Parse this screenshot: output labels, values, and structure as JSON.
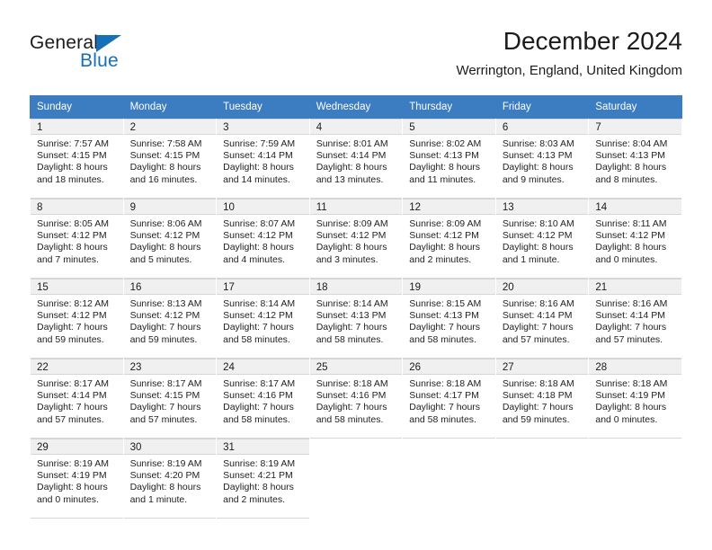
{
  "logo": {
    "word_dark": "General",
    "word_blue": "Blue",
    "triangle_color": "#1570b8"
  },
  "header": {
    "title": "December 2024",
    "subtitle": "Werrington, England, United Kingdom",
    "header_bg": "#3c7cc0",
    "daynum_bg": "#f0f0f0"
  },
  "weekdays": [
    "Sunday",
    "Monday",
    "Tuesday",
    "Wednesday",
    "Thursday",
    "Friday",
    "Saturday"
  ],
  "weeks": [
    [
      {
        "day": "1",
        "sunrise": "Sunrise: 7:57 AM",
        "sunset": "Sunset: 4:15 PM",
        "daylight1": "Daylight: 8 hours",
        "daylight2": "and 18 minutes."
      },
      {
        "day": "2",
        "sunrise": "Sunrise: 7:58 AM",
        "sunset": "Sunset: 4:15 PM",
        "daylight1": "Daylight: 8 hours",
        "daylight2": "and 16 minutes."
      },
      {
        "day": "3",
        "sunrise": "Sunrise: 7:59 AM",
        "sunset": "Sunset: 4:14 PM",
        "daylight1": "Daylight: 8 hours",
        "daylight2": "and 14 minutes."
      },
      {
        "day": "4",
        "sunrise": "Sunrise: 8:01 AM",
        "sunset": "Sunset: 4:14 PM",
        "daylight1": "Daylight: 8 hours",
        "daylight2": "and 13 minutes."
      },
      {
        "day": "5",
        "sunrise": "Sunrise: 8:02 AM",
        "sunset": "Sunset: 4:13 PM",
        "daylight1": "Daylight: 8 hours",
        "daylight2": "and 11 minutes."
      },
      {
        "day": "6",
        "sunrise": "Sunrise: 8:03 AM",
        "sunset": "Sunset: 4:13 PM",
        "daylight1": "Daylight: 8 hours",
        "daylight2": "and 9 minutes."
      },
      {
        "day": "7",
        "sunrise": "Sunrise: 8:04 AM",
        "sunset": "Sunset: 4:13 PM",
        "daylight1": "Daylight: 8 hours",
        "daylight2": "and 8 minutes."
      }
    ],
    [
      {
        "day": "8",
        "sunrise": "Sunrise: 8:05 AM",
        "sunset": "Sunset: 4:12 PM",
        "daylight1": "Daylight: 8 hours",
        "daylight2": "and 7 minutes."
      },
      {
        "day": "9",
        "sunrise": "Sunrise: 8:06 AM",
        "sunset": "Sunset: 4:12 PM",
        "daylight1": "Daylight: 8 hours",
        "daylight2": "and 5 minutes."
      },
      {
        "day": "10",
        "sunrise": "Sunrise: 8:07 AM",
        "sunset": "Sunset: 4:12 PM",
        "daylight1": "Daylight: 8 hours",
        "daylight2": "and 4 minutes."
      },
      {
        "day": "11",
        "sunrise": "Sunrise: 8:09 AM",
        "sunset": "Sunset: 4:12 PM",
        "daylight1": "Daylight: 8 hours",
        "daylight2": "and 3 minutes."
      },
      {
        "day": "12",
        "sunrise": "Sunrise: 8:09 AM",
        "sunset": "Sunset: 4:12 PM",
        "daylight1": "Daylight: 8 hours",
        "daylight2": "and 2 minutes."
      },
      {
        "day": "13",
        "sunrise": "Sunrise: 8:10 AM",
        "sunset": "Sunset: 4:12 PM",
        "daylight1": "Daylight: 8 hours",
        "daylight2": "and 1 minute."
      },
      {
        "day": "14",
        "sunrise": "Sunrise: 8:11 AM",
        "sunset": "Sunset: 4:12 PM",
        "daylight1": "Daylight: 8 hours",
        "daylight2": "and 0 minutes."
      }
    ],
    [
      {
        "day": "15",
        "sunrise": "Sunrise: 8:12 AM",
        "sunset": "Sunset: 4:12 PM",
        "daylight1": "Daylight: 7 hours",
        "daylight2": "and 59 minutes."
      },
      {
        "day": "16",
        "sunrise": "Sunrise: 8:13 AM",
        "sunset": "Sunset: 4:12 PM",
        "daylight1": "Daylight: 7 hours",
        "daylight2": "and 59 minutes."
      },
      {
        "day": "17",
        "sunrise": "Sunrise: 8:14 AM",
        "sunset": "Sunset: 4:12 PM",
        "daylight1": "Daylight: 7 hours",
        "daylight2": "and 58 minutes."
      },
      {
        "day": "18",
        "sunrise": "Sunrise: 8:14 AM",
        "sunset": "Sunset: 4:13 PM",
        "daylight1": "Daylight: 7 hours",
        "daylight2": "and 58 minutes."
      },
      {
        "day": "19",
        "sunrise": "Sunrise: 8:15 AM",
        "sunset": "Sunset: 4:13 PM",
        "daylight1": "Daylight: 7 hours",
        "daylight2": "and 58 minutes."
      },
      {
        "day": "20",
        "sunrise": "Sunrise: 8:16 AM",
        "sunset": "Sunset: 4:14 PM",
        "daylight1": "Daylight: 7 hours",
        "daylight2": "and 57 minutes."
      },
      {
        "day": "21",
        "sunrise": "Sunrise: 8:16 AM",
        "sunset": "Sunset: 4:14 PM",
        "daylight1": "Daylight: 7 hours",
        "daylight2": "and 57 minutes."
      }
    ],
    [
      {
        "day": "22",
        "sunrise": "Sunrise: 8:17 AM",
        "sunset": "Sunset: 4:14 PM",
        "daylight1": "Daylight: 7 hours",
        "daylight2": "and 57 minutes."
      },
      {
        "day": "23",
        "sunrise": "Sunrise: 8:17 AM",
        "sunset": "Sunset: 4:15 PM",
        "daylight1": "Daylight: 7 hours",
        "daylight2": "and 57 minutes."
      },
      {
        "day": "24",
        "sunrise": "Sunrise: 8:17 AM",
        "sunset": "Sunset: 4:16 PM",
        "daylight1": "Daylight: 7 hours",
        "daylight2": "and 58 minutes."
      },
      {
        "day": "25",
        "sunrise": "Sunrise: 8:18 AM",
        "sunset": "Sunset: 4:16 PM",
        "daylight1": "Daylight: 7 hours",
        "daylight2": "and 58 minutes."
      },
      {
        "day": "26",
        "sunrise": "Sunrise: 8:18 AM",
        "sunset": "Sunset: 4:17 PM",
        "daylight1": "Daylight: 7 hours",
        "daylight2": "and 58 minutes."
      },
      {
        "day": "27",
        "sunrise": "Sunrise: 8:18 AM",
        "sunset": "Sunset: 4:18 PM",
        "daylight1": "Daylight: 7 hours",
        "daylight2": "and 59 minutes."
      },
      {
        "day": "28",
        "sunrise": "Sunrise: 8:18 AM",
        "sunset": "Sunset: 4:19 PM",
        "daylight1": "Daylight: 8 hours",
        "daylight2": "and 0 minutes."
      }
    ],
    [
      {
        "day": "29",
        "sunrise": "Sunrise: 8:19 AM",
        "sunset": "Sunset: 4:19 PM",
        "daylight1": "Daylight: 8 hours",
        "daylight2": "and 0 minutes."
      },
      {
        "day": "30",
        "sunrise": "Sunrise: 8:19 AM",
        "sunset": "Sunset: 4:20 PM",
        "daylight1": "Daylight: 8 hours",
        "daylight2": "and 1 minute."
      },
      {
        "day": "31",
        "sunrise": "Sunrise: 8:19 AM",
        "sunset": "Sunset: 4:21 PM",
        "daylight1": "Daylight: 8 hours",
        "daylight2": "and 2 minutes."
      },
      {
        "day": "",
        "sunrise": "",
        "sunset": "",
        "daylight1": "",
        "daylight2": ""
      },
      {
        "day": "",
        "sunrise": "",
        "sunset": "",
        "daylight1": "",
        "daylight2": ""
      },
      {
        "day": "",
        "sunrise": "",
        "sunset": "",
        "daylight1": "",
        "daylight2": ""
      },
      {
        "day": "",
        "sunrise": "",
        "sunset": "",
        "daylight1": "",
        "daylight2": ""
      }
    ]
  ]
}
